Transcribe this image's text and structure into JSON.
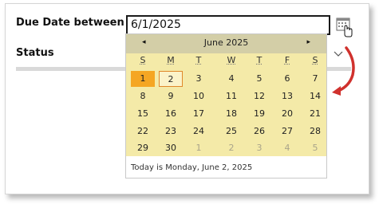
{
  "form": {
    "due_label": "Due Date between",
    "status_label": "Status",
    "date_value": "6/1/2025"
  },
  "calendar": {
    "title": "June 2025",
    "prev": "◂",
    "next": "▸",
    "weekdays": [
      "S",
      "M",
      "T",
      "W",
      "T",
      "F",
      "S"
    ],
    "weeks": [
      [
        "1",
        "2",
        "3",
        "4",
        "5",
        "6",
        "7"
      ],
      [
        "8",
        "9",
        "10",
        "11",
        "12",
        "13",
        "14"
      ],
      [
        "15",
        "16",
        "17",
        "18",
        "19",
        "20",
        "21"
      ],
      [
        "22",
        "23",
        "24",
        "25",
        "26",
        "27",
        "28"
      ],
      [
        "29",
        "30",
        "1",
        "2",
        "3",
        "4",
        "5"
      ]
    ],
    "selected": "1",
    "today": "2",
    "footer": "Today is Monday, June 2, 2025"
  },
  "colors": {
    "header_bg": "#d3cea7",
    "body_bg": "#f4eaa8",
    "selected_bg": "#f5a623",
    "arrow_red": "#d0312d"
  },
  "icons": {
    "calendar_button": "calendar-icon",
    "status_dropdown": "chevron-down-icon",
    "annotation": "curved-arrow-icon"
  }
}
